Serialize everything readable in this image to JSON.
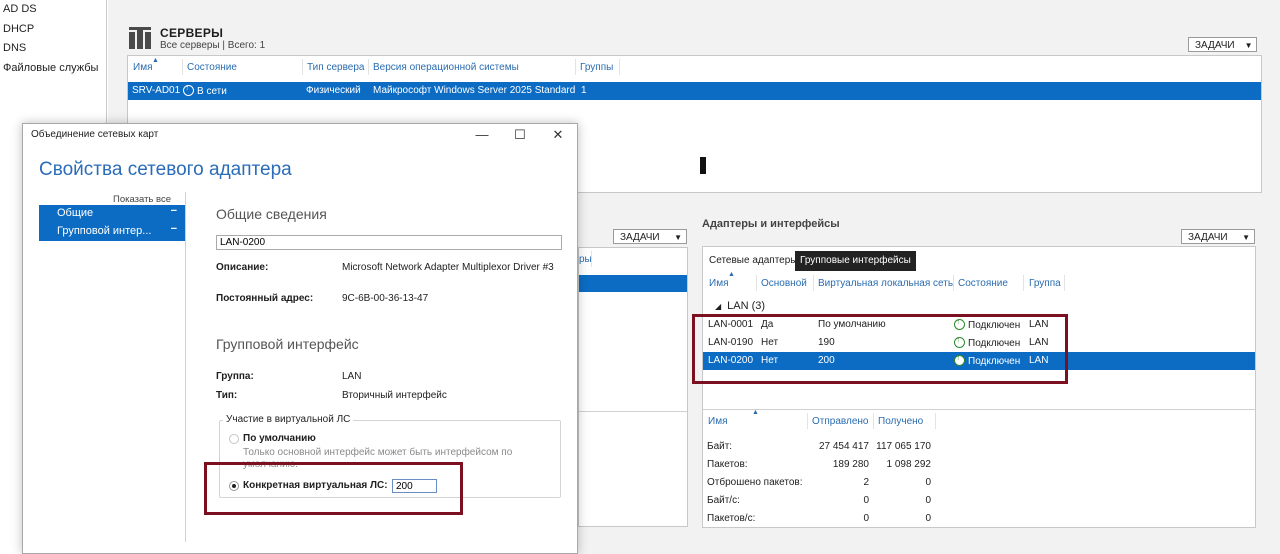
{
  "nav": {
    "items": [
      "AD DS",
      "DHCP",
      "DNS",
      "Файловые службы"
    ]
  },
  "servers": {
    "title": "СЕРВЕРЫ",
    "subtitle": "Все серверы | Всего: 1",
    "tasks_label": "ЗАДАЧИ",
    "columns": [
      "Имя",
      "Состояние",
      "Тип сервера",
      "Версия операционной системы",
      "Группы"
    ],
    "row": {
      "name": "SRV-AD01",
      "status": "В сети",
      "type": "Физический",
      "os": "Майкрософт Windows Server 2025 Standard",
      "groups": "1"
    }
  },
  "mid_panel": {
    "tasks_label": "ЗАДАЧИ",
    "col_fragment": "ры"
  },
  "adapters": {
    "title": "Адаптеры и интерфейсы",
    "tasks_label": "ЗАДАЧИ",
    "tabs": [
      "Сетевые адаптеры",
      "Групповые интерфейсы"
    ],
    "columns": [
      "Имя",
      "Основной",
      "Виртуальная локальная сеть",
      "Состояние",
      "Группа"
    ],
    "group_label": "LAN (3)",
    "rows": [
      {
        "name": "LAN-0001",
        "primary": "Да",
        "vlan": "По умолчанию",
        "status": "Подключен",
        "group": "LAN"
      },
      {
        "name": "LAN-0190",
        "primary": "Нет",
        "vlan": "190",
        "status": "Подключен",
        "group": "LAN"
      },
      {
        "name": "LAN-0200",
        "primary": "Нет",
        "vlan": "200",
        "status": "Подключен",
        "group": "LAN"
      }
    ],
    "stats_columns": [
      "Имя",
      "Отправлено",
      "Получено"
    ],
    "stats": [
      {
        "label": "Байт:",
        "sent": "27 454 417",
        "recv": "117 065 170"
      },
      {
        "label": "Пакетов:",
        "sent": "189 280",
        "recv": "1 098 292"
      },
      {
        "label": "Отброшено пакетов:",
        "sent": "2",
        "recv": "0"
      },
      {
        "label": "Байт/с:",
        "sent": "0",
        "recv": "0"
      },
      {
        "label": "Пакетов/с:",
        "sent": "0",
        "recv": "0"
      }
    ]
  },
  "dialog": {
    "window_title": "Объединение сетевых карт",
    "heading": "Свойства сетевого адаптера",
    "show_all": "Показать все",
    "side_items": [
      "Общие",
      "Групповой интер..."
    ],
    "general_title": "Общие сведения",
    "name_value": "LAN-0200",
    "description_label": "Описание:",
    "description_value": "Microsoft Network Adapter Multiplexor Driver #3",
    "mac_label": "Постоянный адрес:",
    "mac_value": "9C-6B-00-36-13-47",
    "team_title": "Групповой интерфейс",
    "group_label": "Группа:",
    "group_value": "LAN",
    "type_label": "Тип:",
    "type_value": "Вторичный интерфейс",
    "vlan_group_legend": "Участие в виртуальной ЛС",
    "radio_default_label": "По умолчанию",
    "radio_default_hint": "Только основной интерфейс может быть интерфейсом по умолчанию.",
    "radio_specific_label": "Конкретная виртуальная ЛС:",
    "vlan_value": "200"
  },
  "colors": {
    "selection": "#0c6cc4",
    "accent_heading": "#2b6cb8",
    "highlight_border": "#7a1020",
    "status_green": "#2d8a2d"
  }
}
